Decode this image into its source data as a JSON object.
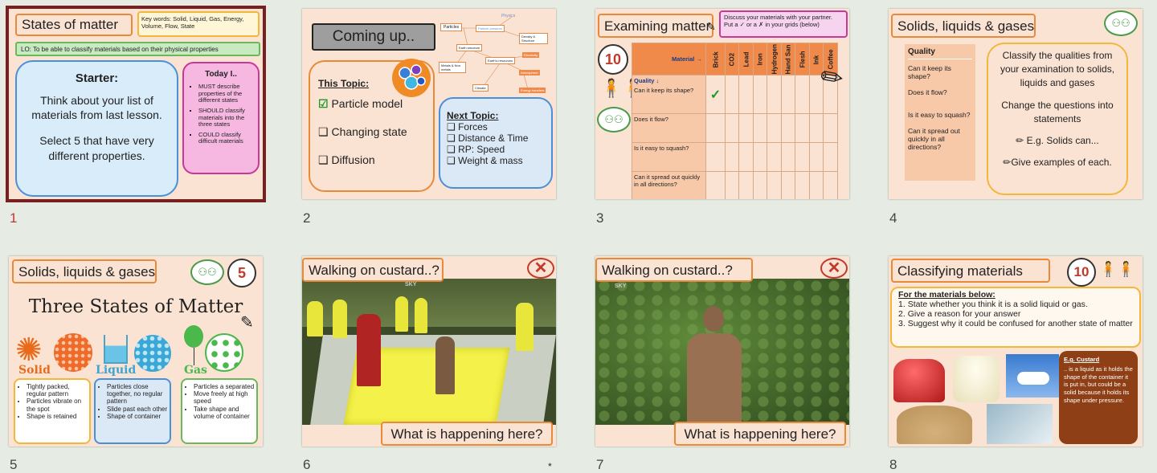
{
  "slides": [
    {
      "number": "1",
      "title": "States of matter",
      "keywords": "Key words: Solid, Liquid, Gas, Energy, Volume, Flow, State",
      "lo": "LO: To be able to classify materials based on their physical properties",
      "starter_heading": "Starter:",
      "starter_text1": "Think about your list of materials from last lesson.",
      "starter_text2": "Select 5 that have very different properties.",
      "today_heading": "Today I..",
      "today_items": [
        "MUST describe properties of the different states",
        "SHOULD classify materials into the three states",
        "COULD classify difficult materials"
      ]
    },
    {
      "number": "2",
      "title": "Coming up..",
      "this_topic": "This Topic:",
      "topic_items": [
        "Particle model",
        "Changing state",
        "Diffusion"
      ],
      "next_topic": "Next Topic:",
      "next_items": [
        "Forces",
        "Distance & Time",
        "RP: Speed",
        "Weight & mass"
      ],
      "map_nodes": [
        "Physics",
        "Particles",
        "Particle pressure",
        "Density & Structure",
        "Earth structure",
        "Electricity",
        "Metals & Non metals",
        "Earth's resources",
        "Atmosphere",
        "Climate",
        "Energy transfers"
      ]
    },
    {
      "number": "3",
      "title": "Examining matter",
      "instruction": "Discuss your materials with your partner. Put a ✓ or a ✗ in your grids (below)",
      "timer": "10",
      "material_label": "Material",
      "quality_label": "Quality",
      "materials": [
        "Brick",
        "CO2",
        "Lead",
        "Iron",
        "Hydrogen",
        "Hand San",
        "Flesh",
        "Ink",
        "Coffee"
      ],
      "questions": [
        "Can it keep its shape?",
        "Does it flow?",
        "Is it easy to squash?",
        "Can it spread out quickly in all directions?"
      ]
    },
    {
      "number": "4",
      "title": "Solids, liquids & gases",
      "quality_label": "Quality",
      "qualities": [
        "Can it keep its shape?",
        "Does it flow?",
        "Is it easy to squash?",
        "Can it spread out quickly in all directions?"
      ],
      "task1": "Classify the qualities from your examination to solids, liquids and gases",
      "task2": "Change the questions into statements",
      "task3": "E.g. Solids can...",
      "task4": "Give examples of each."
    },
    {
      "number": "5",
      "title": "Solids, liquids & gases",
      "timer": "5",
      "heading": "Three States of Matter",
      "states": [
        {
          "name": "Solid",
          "points": [
            "Tightly packed, regular pattern",
            "Particles vibrate on the spot",
            "Shape is retained"
          ]
        },
        {
          "name": "Liquid",
          "points": [
            "Particles close together, no regular pattern",
            "Slide past each other",
            "Shape of container"
          ]
        },
        {
          "name": "Gas",
          "points": [
            "Particles a separated",
            "Move freely at high speed",
            "Take shape and volume of container"
          ]
        }
      ]
    },
    {
      "number": "6",
      "title": "Walking on custard..?",
      "question": "What is happening here?",
      "badge": "SKY"
    },
    {
      "number": "7",
      "title": "Walking on custard..?",
      "question": "What is happening here?",
      "badge": "SKY"
    },
    {
      "number": "8",
      "title": "Classifying materials",
      "timer": "10",
      "intro": "For the materials below:",
      "steps": [
        "State whether you think it is a solid liquid or gas.",
        "Give a reason for your answer",
        "Suggest why it could be confused for another state of matter"
      ],
      "example_title": "E.g. Custard",
      "example_text": ".. is a liquid as it holds the shape of the container it is put in, but could be a solid because it holds its shape under pressure."
    }
  ],
  "colors": {
    "slide_bg": "#fbe3d3",
    "accent_orange": "#e98a3a",
    "pink": "#f6b7e0",
    "blue_box": "#dbe8f6",
    "selected_border": "#7a1f1f"
  }
}
